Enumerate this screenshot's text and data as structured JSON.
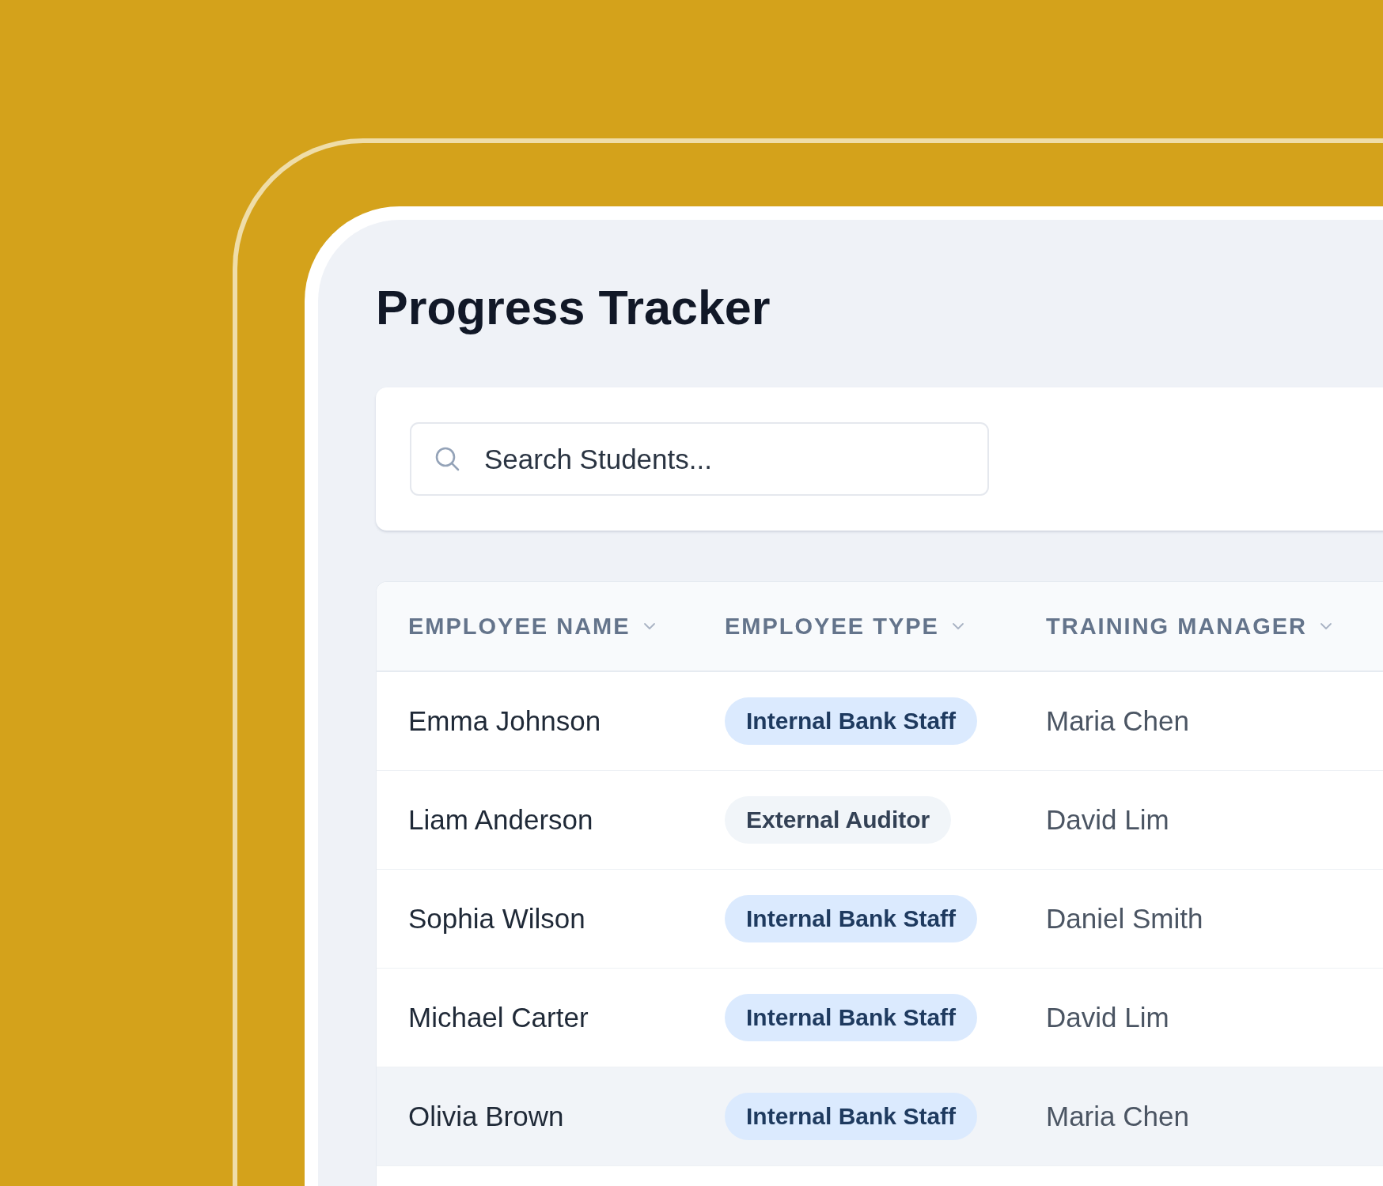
{
  "title": "Progress Tracker",
  "search": {
    "placeholder": "Search Students..."
  },
  "table": {
    "columns": [
      {
        "label": "EMPLOYEE NAME",
        "sortable": true
      },
      {
        "label": "EMPLOYEE TYPE",
        "sortable": true
      },
      {
        "label": "TRAINING MANAGER",
        "sortable": true
      }
    ],
    "rows": [
      {
        "employee_name": "Emma Johnson",
        "employee_type": {
          "label": "Internal Bank Staff",
          "kind": "internal"
        },
        "training_manager": "Maria Chen",
        "selected": false
      },
      {
        "employee_name": "Liam Anderson",
        "employee_type": {
          "label": "External Auditor",
          "kind": "external"
        },
        "training_manager": "David Lim",
        "selected": false
      },
      {
        "employee_name": "Sophia Wilson",
        "employee_type": {
          "label": "Internal Bank Staff",
          "kind": "internal"
        },
        "training_manager": "Daniel Smith",
        "selected": false
      },
      {
        "employee_name": "Michael Carter",
        "employee_type": {
          "label": "Internal Bank Staff",
          "kind": "internal"
        },
        "training_manager": "David Lim",
        "selected": false
      },
      {
        "employee_name": "Olivia Brown",
        "employee_type": {
          "label": "Internal Bank Staff",
          "kind": "internal"
        },
        "training_manager": "Maria Chen",
        "selected": true
      }
    ]
  }
}
